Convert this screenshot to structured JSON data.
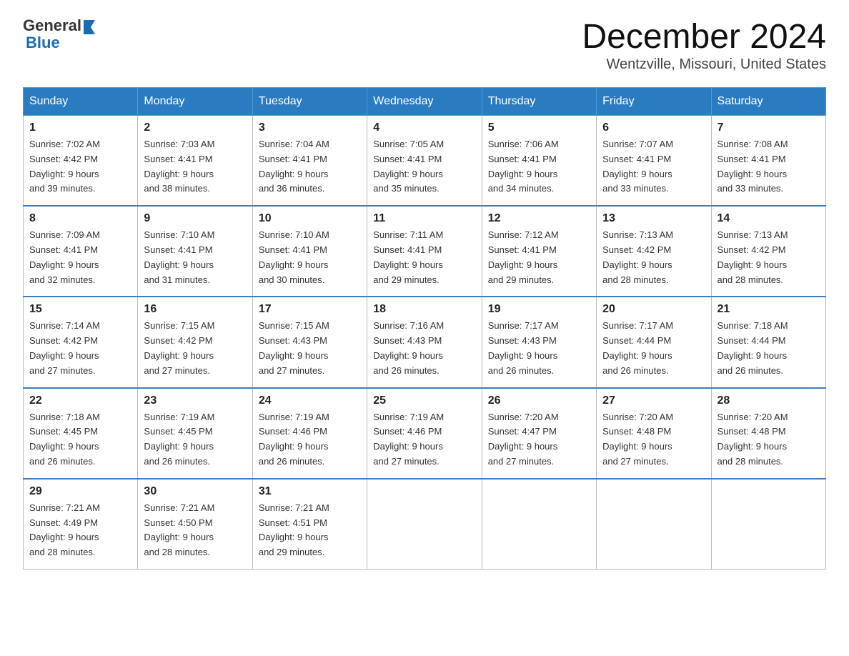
{
  "header": {
    "logo_general": "General",
    "logo_blue": "Blue",
    "month_title": "December 2024",
    "location": "Wentzville, Missouri, United States"
  },
  "weekdays": [
    "Sunday",
    "Monday",
    "Tuesday",
    "Wednesday",
    "Thursday",
    "Friday",
    "Saturday"
  ],
  "weeks": [
    [
      {
        "day": "1",
        "sunrise": "7:02 AM",
        "sunset": "4:42 PM",
        "daylight": "9 hours and 39 minutes."
      },
      {
        "day": "2",
        "sunrise": "7:03 AM",
        "sunset": "4:41 PM",
        "daylight": "9 hours and 38 minutes."
      },
      {
        "day": "3",
        "sunrise": "7:04 AM",
        "sunset": "4:41 PM",
        "daylight": "9 hours and 36 minutes."
      },
      {
        "day": "4",
        "sunrise": "7:05 AM",
        "sunset": "4:41 PM",
        "daylight": "9 hours and 35 minutes."
      },
      {
        "day": "5",
        "sunrise": "7:06 AM",
        "sunset": "4:41 PM",
        "daylight": "9 hours and 34 minutes."
      },
      {
        "day": "6",
        "sunrise": "7:07 AM",
        "sunset": "4:41 PM",
        "daylight": "9 hours and 33 minutes."
      },
      {
        "day": "7",
        "sunrise": "7:08 AM",
        "sunset": "4:41 PM",
        "daylight": "9 hours and 33 minutes."
      }
    ],
    [
      {
        "day": "8",
        "sunrise": "7:09 AM",
        "sunset": "4:41 PM",
        "daylight": "9 hours and 32 minutes."
      },
      {
        "day": "9",
        "sunrise": "7:10 AM",
        "sunset": "4:41 PM",
        "daylight": "9 hours and 31 minutes."
      },
      {
        "day": "10",
        "sunrise": "7:10 AM",
        "sunset": "4:41 PM",
        "daylight": "9 hours and 30 minutes."
      },
      {
        "day": "11",
        "sunrise": "7:11 AM",
        "sunset": "4:41 PM",
        "daylight": "9 hours and 29 minutes."
      },
      {
        "day": "12",
        "sunrise": "7:12 AM",
        "sunset": "4:41 PM",
        "daylight": "9 hours and 29 minutes."
      },
      {
        "day": "13",
        "sunrise": "7:13 AM",
        "sunset": "4:42 PM",
        "daylight": "9 hours and 28 minutes."
      },
      {
        "day": "14",
        "sunrise": "7:13 AM",
        "sunset": "4:42 PM",
        "daylight": "9 hours and 28 minutes."
      }
    ],
    [
      {
        "day": "15",
        "sunrise": "7:14 AM",
        "sunset": "4:42 PM",
        "daylight": "9 hours and 27 minutes."
      },
      {
        "day": "16",
        "sunrise": "7:15 AM",
        "sunset": "4:42 PM",
        "daylight": "9 hours and 27 minutes."
      },
      {
        "day": "17",
        "sunrise": "7:15 AM",
        "sunset": "4:43 PM",
        "daylight": "9 hours and 27 minutes."
      },
      {
        "day": "18",
        "sunrise": "7:16 AM",
        "sunset": "4:43 PM",
        "daylight": "9 hours and 26 minutes."
      },
      {
        "day": "19",
        "sunrise": "7:17 AM",
        "sunset": "4:43 PM",
        "daylight": "9 hours and 26 minutes."
      },
      {
        "day": "20",
        "sunrise": "7:17 AM",
        "sunset": "4:44 PM",
        "daylight": "9 hours and 26 minutes."
      },
      {
        "day": "21",
        "sunrise": "7:18 AM",
        "sunset": "4:44 PM",
        "daylight": "9 hours and 26 minutes."
      }
    ],
    [
      {
        "day": "22",
        "sunrise": "7:18 AM",
        "sunset": "4:45 PM",
        "daylight": "9 hours and 26 minutes."
      },
      {
        "day": "23",
        "sunrise": "7:19 AM",
        "sunset": "4:45 PM",
        "daylight": "9 hours and 26 minutes."
      },
      {
        "day": "24",
        "sunrise": "7:19 AM",
        "sunset": "4:46 PM",
        "daylight": "9 hours and 26 minutes."
      },
      {
        "day": "25",
        "sunrise": "7:19 AM",
        "sunset": "4:46 PM",
        "daylight": "9 hours and 27 minutes."
      },
      {
        "day": "26",
        "sunrise": "7:20 AM",
        "sunset": "4:47 PM",
        "daylight": "9 hours and 27 minutes."
      },
      {
        "day": "27",
        "sunrise": "7:20 AM",
        "sunset": "4:48 PM",
        "daylight": "9 hours and 27 minutes."
      },
      {
        "day": "28",
        "sunrise": "7:20 AM",
        "sunset": "4:48 PM",
        "daylight": "9 hours and 28 minutes."
      }
    ],
    [
      {
        "day": "29",
        "sunrise": "7:21 AM",
        "sunset": "4:49 PM",
        "daylight": "9 hours and 28 minutes."
      },
      {
        "day": "30",
        "sunrise": "7:21 AM",
        "sunset": "4:50 PM",
        "daylight": "9 hours and 28 minutes."
      },
      {
        "day": "31",
        "sunrise": "7:21 AM",
        "sunset": "4:51 PM",
        "daylight": "9 hours and 29 minutes."
      },
      null,
      null,
      null,
      null
    ]
  ],
  "labels": {
    "sunrise": "Sunrise:",
    "sunset": "Sunset:",
    "daylight": "Daylight:"
  }
}
